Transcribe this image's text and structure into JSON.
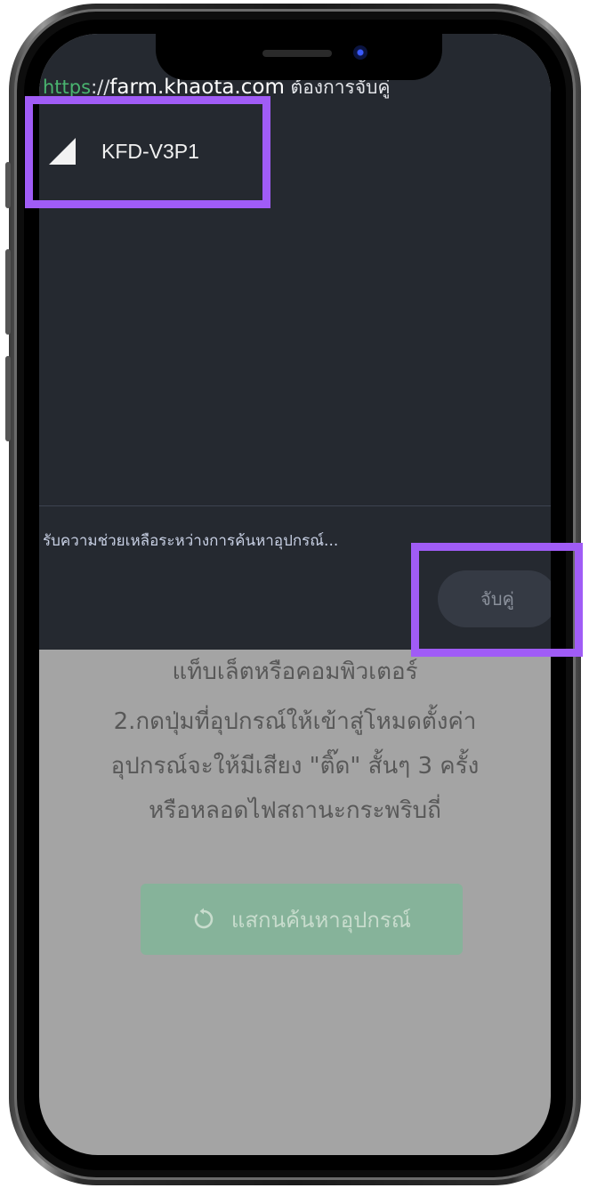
{
  "dialog": {
    "title_scheme": "https",
    "title_separator": "://",
    "title_host": "farm.khaota.com",
    "title_suffix": " ต้องการจับคู่",
    "device_name": "KFD-V3P1",
    "help_text": "รับความช่วยเหลือระหว่างการค้นหาอุปกรณ์...",
    "pair_button": "จับคู่"
  },
  "background_page": {
    "instruction_line_1": "แท็บเล็ตหรือคอมพิวเตอร์",
    "instruction_line_2": "2.กดปุ่มที่อุปกรณ์ให้เข้าสู่โหมดตั้งค่า",
    "instruction_line_3": "อุปกรณ์จะให้มีเสียง \"ติ๊ด\" สั้นๆ 3 ครั้ง",
    "instruction_line_4": "หรือหลอดไฟสถานะกระพริบถี่",
    "scan_button": "แสกนค้นหาอุปกรณ์"
  },
  "icons": {
    "signal": "signal-strength-icon",
    "refresh": "refresh-icon"
  },
  "colors": {
    "dialog_background": "#252930",
    "highlight": "#a05cf6",
    "scan_button": "#86b39a",
    "scheme_text": "#49b36f",
    "dim_overlay": "#a4a4a4"
  }
}
